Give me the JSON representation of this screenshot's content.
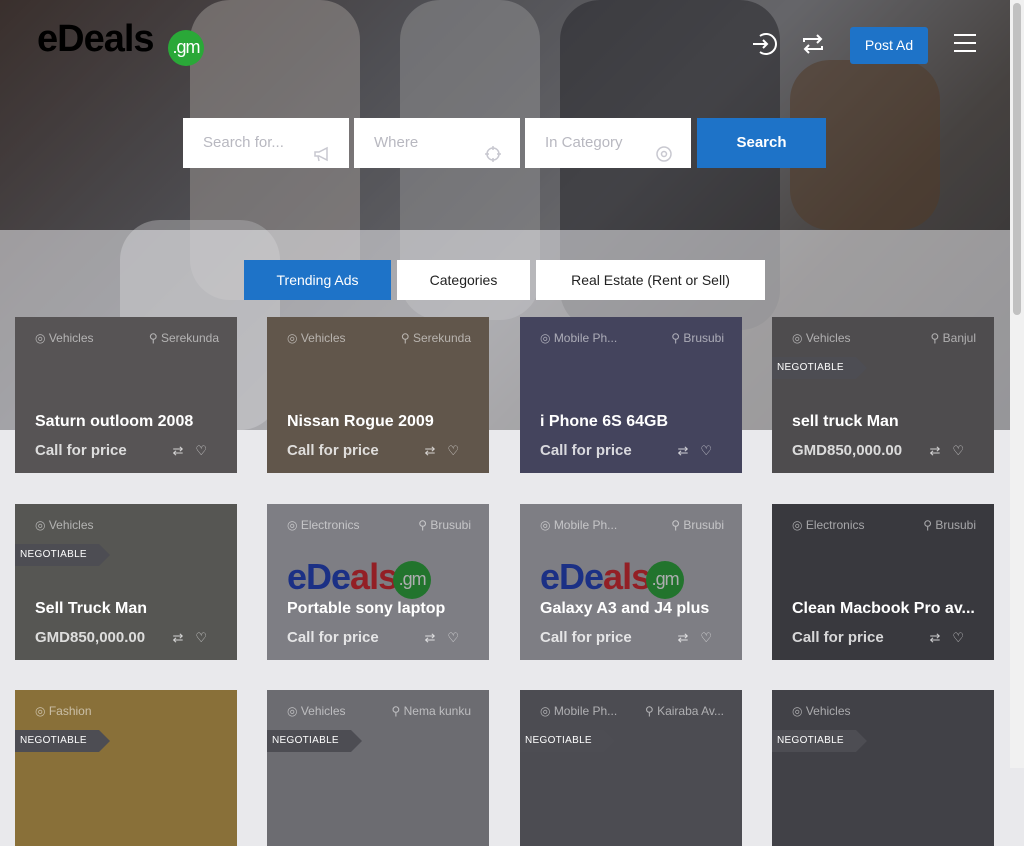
{
  "brand": {
    "logo_main": "eDeals",
    "logo_tld": ".gm"
  },
  "header": {
    "post_ad_label": "Post Ad"
  },
  "search": {
    "keyword_placeholder": "Search for...",
    "location_placeholder": "Where",
    "category_placeholder": "In Category",
    "button_label": "Search"
  },
  "tabs": [
    {
      "label": "Trending Ads",
      "active": true
    },
    {
      "label": "Categories",
      "active": false
    },
    {
      "label": "Real Estate (Rent or Sell)",
      "active": false
    }
  ],
  "listings": [
    {
      "category": "Vehicles",
      "location": "Serekunda",
      "title": "Saturn outloom 2008",
      "price": "Call for price",
      "badge": ""
    },
    {
      "category": "Vehicles",
      "location": "Serekunda",
      "title": "Nissan Rogue 2009",
      "price": "Call for price",
      "badge": ""
    },
    {
      "category": "Mobile Ph...",
      "location": "Brusubi",
      "title": "i Phone 6S 64GB",
      "price": "Call for price",
      "badge": ""
    },
    {
      "category": "Vehicles",
      "location": "Banjul",
      "title": "sell truck Man",
      "price": "GMD850,000.00",
      "badge": "NEGOTIABLE"
    },
    {
      "category": "Vehicles",
      "location": "",
      "title": "Sell Truck Man",
      "price": "GMD850,000.00",
      "badge": "NEGOTIABLE"
    },
    {
      "category": "Electronics",
      "location": "Brusubi",
      "title": "Portable sony laptop",
      "price": "Call for price",
      "badge": ""
    },
    {
      "category": "Mobile Ph...",
      "location": "Brusubi",
      "title": "Galaxy A3 and J4 plus",
      "price": "Call for price",
      "badge": ""
    },
    {
      "category": "Electronics",
      "location": "Brusubi",
      "title": "Clean Macbook Pro av...",
      "price": "Call for price",
      "badge": ""
    },
    {
      "category": "Fashion",
      "location": "",
      "title": "",
      "price": "",
      "badge": "NEGOTIABLE"
    },
    {
      "category": "Vehicles",
      "location": "Nema kunku",
      "title": "",
      "price": "",
      "badge": "NEGOTIABLE"
    },
    {
      "category": "Mobile Ph...",
      "location": "Kairaba Av...",
      "title": "",
      "price": "",
      "badge": "NEGOTIABLE"
    },
    {
      "category": "Vehicles",
      "location": "",
      "title": "",
      "price": "",
      "badge": "NEGOTIABLE"
    }
  ],
  "colors": {
    "accent": "#1e73c8",
    "brand_blue": "#1f3fbf",
    "brand_red": "#d8262c",
    "brand_green": "#2aa838"
  }
}
